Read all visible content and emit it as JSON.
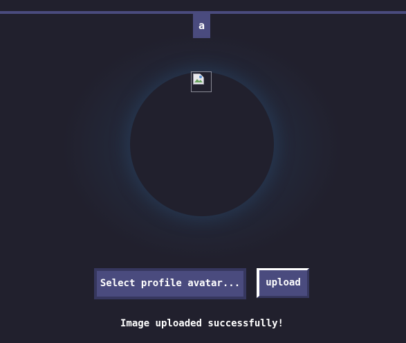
{
  "tab": {
    "label": "a"
  },
  "avatar": {
    "image_state": "broken-image-icon"
  },
  "buttons": {
    "select_label": "Select profile avatar...",
    "upload_label": "upload"
  },
  "status": {
    "message": "Image uploaded successfully!"
  },
  "colors": {
    "background": "#21202d",
    "accent": "#4a4b7e",
    "accent_dark": "#36375e",
    "glow": "#2f4866",
    "text": "#ffffff"
  }
}
